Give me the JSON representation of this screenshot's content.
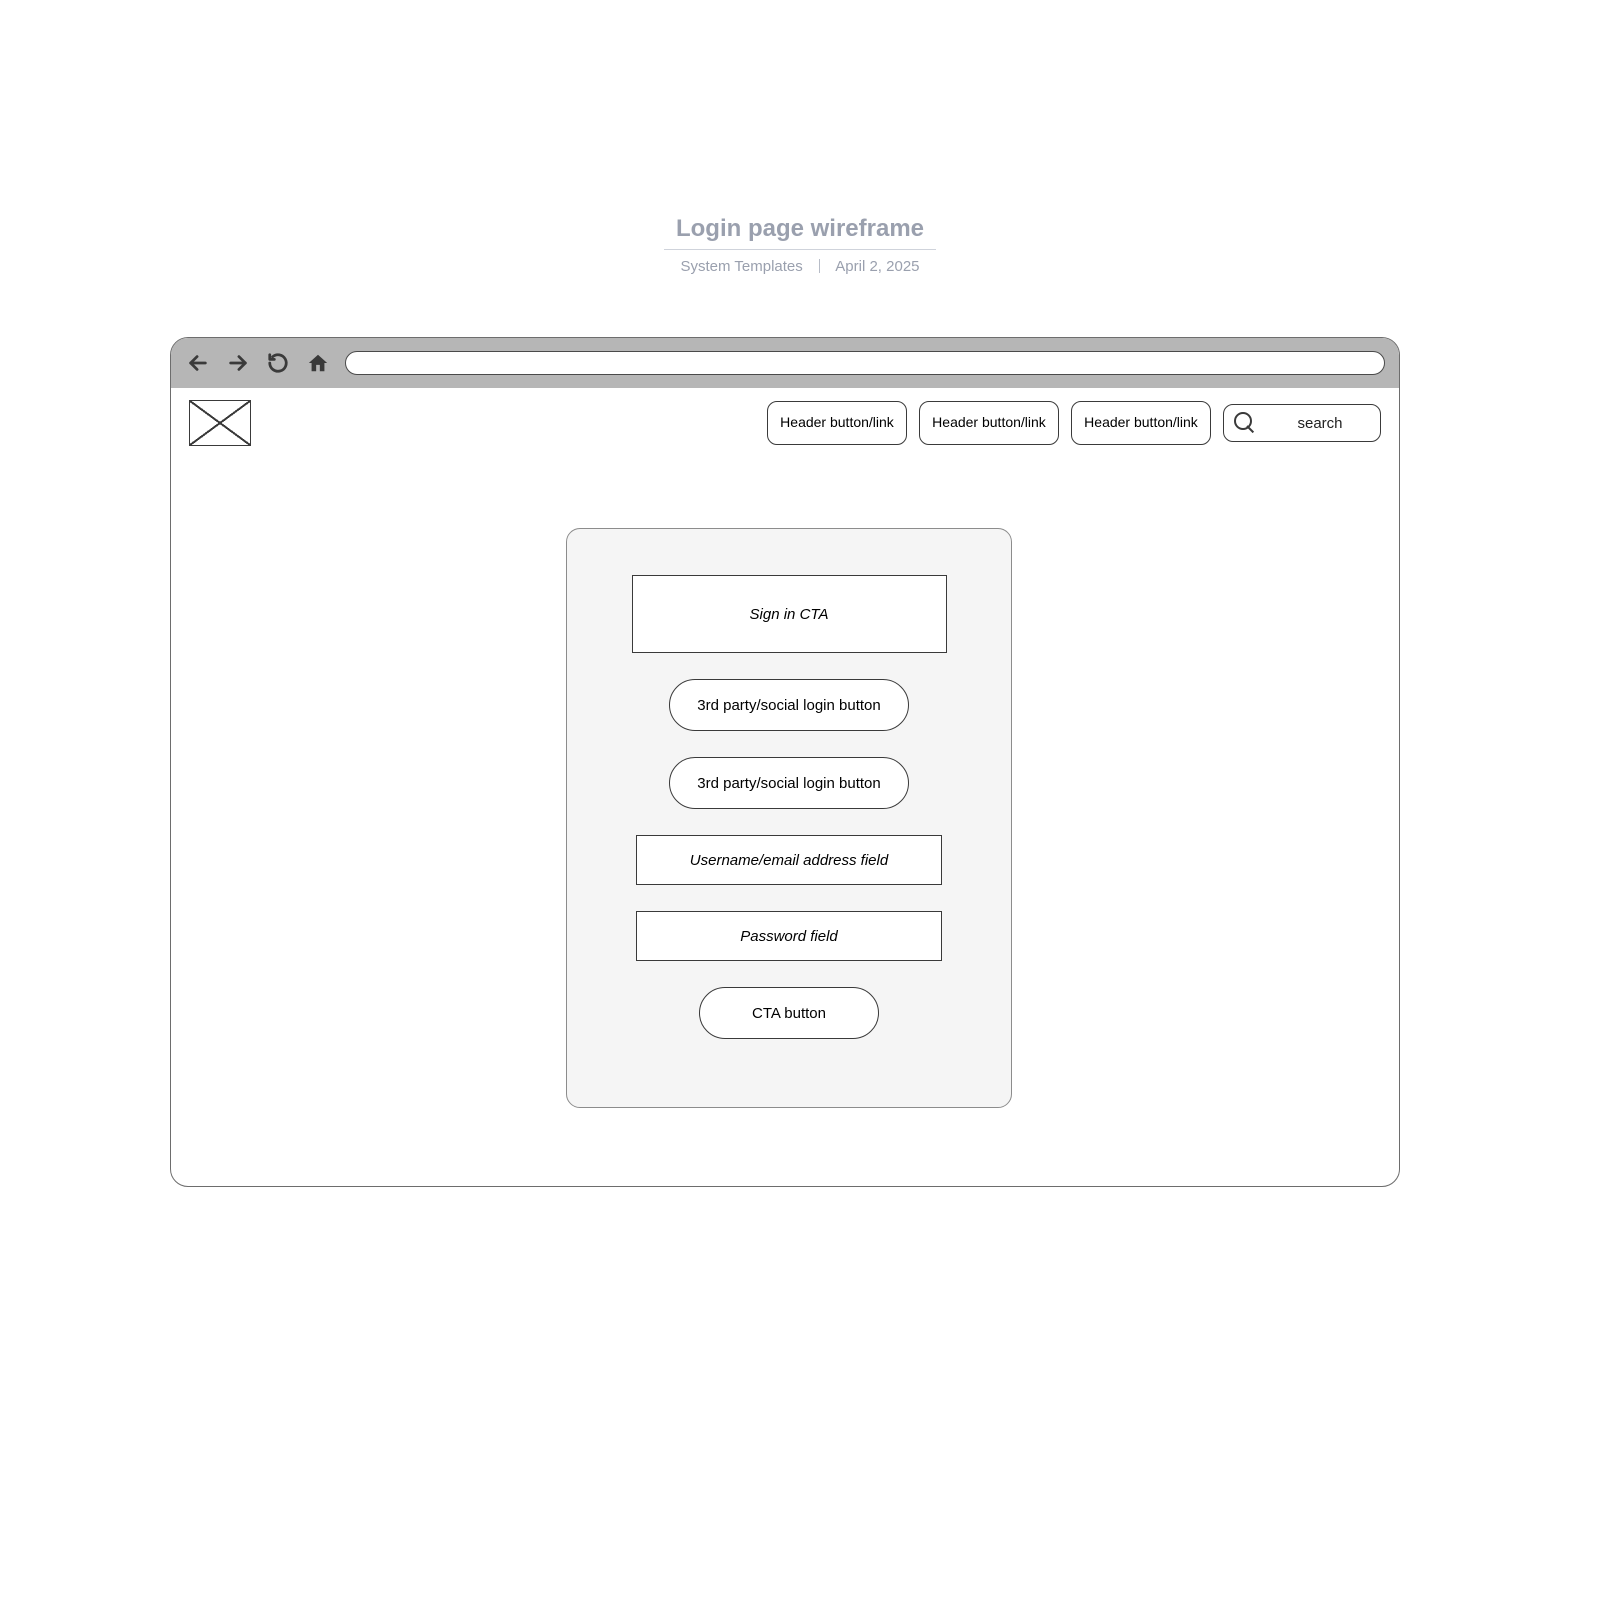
{
  "doc": {
    "title": "Login page wireframe",
    "author": "System Templates",
    "date": "April 2, 2025"
  },
  "header": {
    "buttons": [
      {
        "label": "Header button/link"
      },
      {
        "label": "Header button/link"
      },
      {
        "label": "Header button/link"
      }
    ],
    "search_placeholder": "search"
  },
  "login": {
    "signin_cta": "Sign in CTA",
    "social_buttons": [
      {
        "label": "3rd party/social login button"
      },
      {
        "label": "3rd party/social login button"
      }
    ],
    "username_placeholder": "Username/email address field",
    "password_placeholder": "Password field",
    "cta_label": "CTA button"
  }
}
